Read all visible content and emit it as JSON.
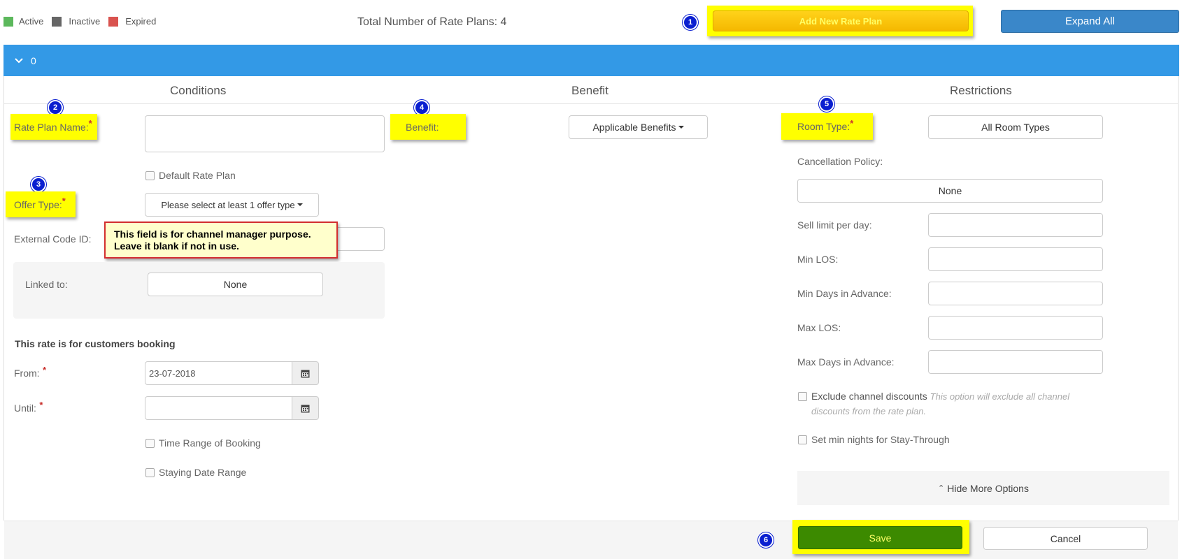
{
  "legend": {
    "active": "Active",
    "inactive": "Inactive",
    "expired": "Expired"
  },
  "colors": {
    "active": "#5cb85c",
    "inactive": "#666666",
    "expired": "#d9534f",
    "accent": "#3399e6",
    "save": "#3c8a00"
  },
  "header": {
    "total_label": "Total Number of Rate Plans: 4",
    "add_new": "Add New Rate Plan",
    "expand_all": "Expand All"
  },
  "panel": {
    "title": "0"
  },
  "columns": {
    "conditions": "Conditions",
    "benefit": "Benefit",
    "restrictions": "Restrictions"
  },
  "markers": [
    "1",
    "2",
    "3",
    "4",
    "5",
    "6"
  ],
  "conditions": {
    "rate_plan_name_label": "Rate Plan Name:",
    "rate_plan_name_value": "",
    "default_rate_plan": "Default Rate Plan",
    "offer_type_label": "Offer Type:",
    "offer_type_value": "Please select at least 1 offer type",
    "external_code_label": "External Code ID:",
    "tooltip": "This field is for channel manager purpose. Leave it blank if not in use.",
    "linked_to_label": "Linked to:",
    "linked_to_value": "None",
    "booking_heading": "This rate is for customers booking",
    "from_label": "From:",
    "from_value": "23-07-2018",
    "until_label": "Until:",
    "until_value": "",
    "time_range": "Time Range of Booking",
    "staying_range": "Staying Date Range"
  },
  "benefit": {
    "label": "Benefit:",
    "button": "Applicable Benefits"
  },
  "restrictions": {
    "room_type_label": "Room Type:",
    "room_type_value": "All Room Types",
    "cancellation_label": "Cancellation Policy:",
    "cancellation_value": "None",
    "sell_limit_label": "Sell limit per day:",
    "min_los_label": "Min LOS:",
    "min_days_label": "Min Days in Advance:",
    "max_los_label": "Max LOS:",
    "max_days_label": "Max Days in Advance:",
    "exclude_label": "Exclude channel discounts",
    "exclude_note": "This option will exclude all channel discounts from the rate plan.",
    "min_nights_label": "Set min nights for Stay-Through",
    "hide_more": "Hide More Options"
  },
  "footer": {
    "save": "Save",
    "cancel": "Cancel"
  }
}
